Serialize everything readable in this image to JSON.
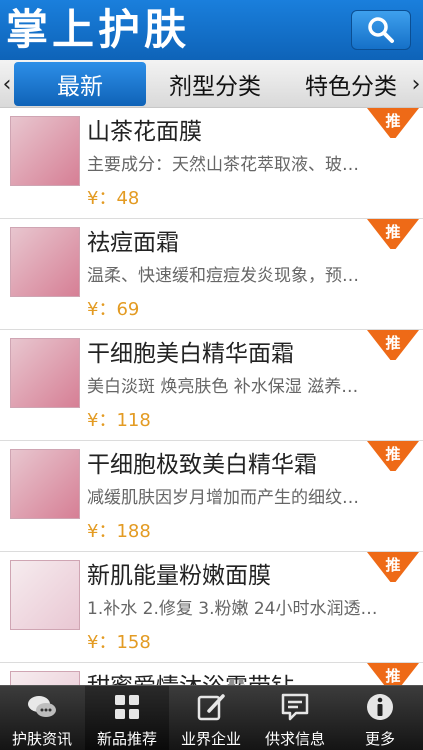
{
  "header": {
    "title": "掌上护肤"
  },
  "tabs": [
    {
      "label": "最新"
    },
    {
      "label": "剂型分类"
    },
    {
      "label": "特色分类"
    }
  ],
  "products": [
    {
      "name": "山茶花面膜",
      "desc": "主要成分：天然山茶花萃取液、玻…",
      "price": "¥：48",
      "badge": "推"
    },
    {
      "name": "祛痘面霜",
      "desc": "温柔、快速缓和痘痘发炎现象，预…",
      "price": "¥：69",
      "badge": "推"
    },
    {
      "name": "干细胞美白精华面霜",
      "desc": "美白淡斑 焕亮肤色 补水保湿 滋养…",
      "price": "¥：118",
      "badge": "推"
    },
    {
      "name": "干细胞极致美白精华霜",
      "desc": "减缓肌肤因岁月增加而产生的细纹…",
      "price": "¥：188",
      "badge": "推"
    },
    {
      "name": "新肌能量粉嫩面膜",
      "desc": "1.补水 2.修复 3.粉嫩 24小时水润透…",
      "price": "¥：158",
      "badge": "推"
    },
    {
      "name": "甜蜜爱情沐浴露带钻",
      "desc": "",
      "price": "",
      "badge": "推"
    }
  ],
  "bottom_nav": [
    {
      "label": "护肤资讯",
      "icon": "chat-bubbles-icon"
    },
    {
      "label": "新品推荐",
      "icon": "grid-icon"
    },
    {
      "label": "业界企业",
      "icon": "edit-note-icon"
    },
    {
      "label": "供求信息",
      "icon": "message-board-icon"
    },
    {
      "label": "更多",
      "icon": "info-icon"
    }
  ],
  "colors": {
    "header": "#1a7fdc",
    "accent_orange": "#ee6a17",
    "price": "#e39b23",
    "nav_bg": "#141414"
  }
}
